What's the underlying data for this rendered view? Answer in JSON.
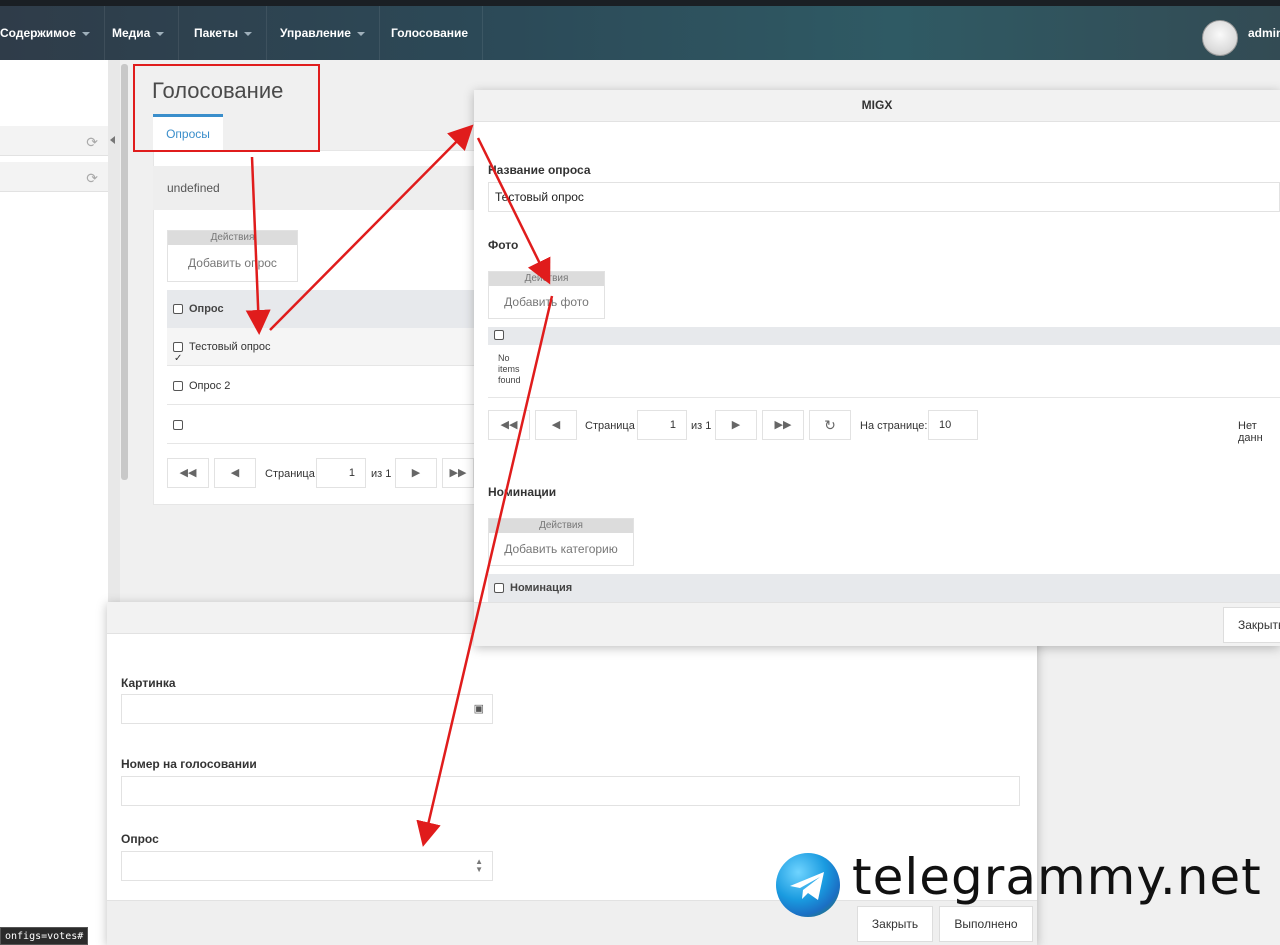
{
  "navbar": {
    "items": [
      {
        "label": "Содержимое"
      },
      {
        "label": "Медиа"
      },
      {
        "label": "Пакеты"
      },
      {
        "label": "Управление"
      },
      {
        "label": "Голосование"
      }
    ],
    "user": "admin"
  },
  "page": {
    "title": "Голосование",
    "tab": "Опросы",
    "panel_header": "undefined",
    "actions_label": "Действия",
    "add_button": "Добавить опрос",
    "grid": {
      "column": "Опрос",
      "rows": [
        {
          "label": "Тестовый опрос",
          "checked": true
        },
        {
          "label": "Опрос 2",
          "checked": false
        },
        {
          "label": "",
          "checked": false
        }
      ]
    },
    "pagination": {
      "page_label": "Страница",
      "page_value": "1",
      "of_label": "из 1"
    }
  },
  "migx": {
    "title": "MIGX",
    "poll_name_label": "Название опроса",
    "poll_name_value": "Тестовый опрос",
    "photo_label": "Фото",
    "photo_actions_label": "Действия",
    "photo_add_button": "Добавить фото",
    "no_items": [
      "No",
      "items",
      "found"
    ],
    "pagination": {
      "page_label": "Страница",
      "page_value": "1",
      "of_label": "из 1",
      "per_page_label": "На странице:",
      "per_page_value": "10",
      "no_data": "Нет данн"
    },
    "nominations_label": "Номинации",
    "nominations_actions_label": "Действия",
    "nominations_add_button": "Добавить категорию",
    "nominations_column": "Номинация",
    "close_button": "Закрыть"
  },
  "bottom_dialog": {
    "image_label": "Картинка",
    "number_label": "Номер на голосовании",
    "poll_label": "Опрос",
    "close_button": "Закрыть",
    "done_button": "Выполнено"
  },
  "status_url": "onfigs=votes#",
  "watermark": "telegrammy.net"
}
